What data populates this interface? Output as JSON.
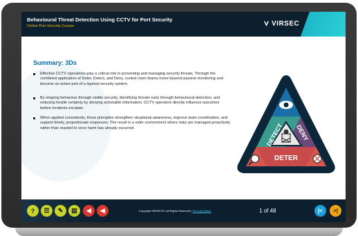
{
  "header": {
    "title": "Behavioural Threat Detection Using CCTV for Port Security",
    "subtitle": "Online Port Security Course",
    "logo_text": "VIRSEC"
  },
  "content": {
    "section_title": "Summary: 3Ds",
    "bullets": [
      "Effective CCTV operations play a critical role in preventing and managing security threats. Through the combined application of Deter, Detect, and Deny, control room teams move beyond passive monitoring and become an active part of a layered security system.",
      "By shaping behaviour through visible security, identifying threats early through behavioural detection, and reducing hostile certainty by denying actionable information, CCTV operators directly influence outcomes before incidents escalate.",
      "When applied consistently, these principles strengthen situational awareness, improve team coordination, and support timely, proportionate responses. The result is a safer environment where risks are managed proactively rather than reacted to once harm has already occurred."
    ],
    "diagram": {
      "labels": {
        "detect": "DETECT",
        "deny": "DENY",
        "deter": "DETER"
      },
      "colors": {
        "detect": "#3a9c8f",
        "deny": "#6b4a7a",
        "deter": "#c94a4a",
        "outline": "#0b2638"
      },
      "icons": [
        "eye-icon",
        "magnifier-icon",
        "no-entry-icon",
        "security-guard-icon"
      ]
    }
  },
  "footer": {
    "buttons": [
      {
        "icon": "help-icon",
        "glyph": "?",
        "color": "#c9d42b"
      },
      {
        "icon": "list-icon",
        "glyph": "☰",
        "color": "#c9d42b"
      },
      {
        "icon": "pencil-icon",
        "glyph": "✎",
        "color": "#c9d42b"
      },
      {
        "icon": "notes-icon",
        "glyph": "▤",
        "color": "#c9d42b"
      },
      {
        "icon": "audio-icon",
        "glyph": "◀",
        "color": "#d93a2f"
      },
      {
        "icon": "mute-icon",
        "glyph": "◀",
        "color": "#d93a2f"
      }
    ],
    "copyright": "Copyright VIRSEC® | All Rights Reserved |",
    "privacy_link": "Security Notice",
    "page_current": "1",
    "page_of": "of",
    "page_total": "48",
    "prev_color": "#1fa0d8",
    "next_color": "#f2a215"
  }
}
